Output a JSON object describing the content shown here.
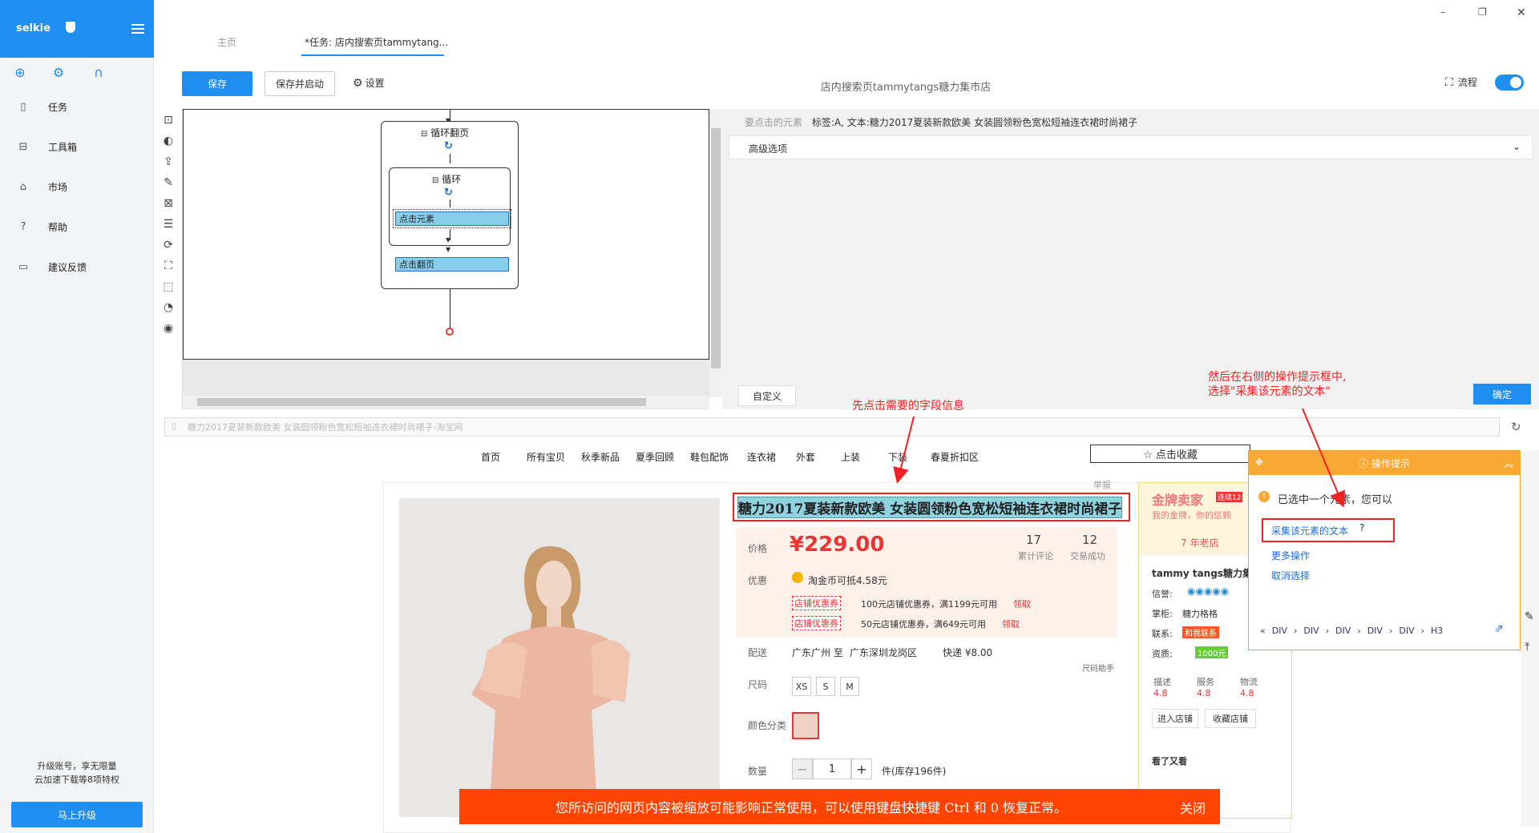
{
  "app": {
    "name": "selkie",
    "menu_label": "menu"
  },
  "sidebar": {
    "items": [
      {
        "label": "任务",
        "icon": "file-icon"
      },
      {
        "label": "工具箱",
        "icon": "toolbox-icon"
      },
      {
        "label": "市场",
        "icon": "bag-icon"
      },
      {
        "label": "帮助",
        "icon": "help-icon"
      },
      {
        "label": "建议反馈",
        "icon": "feedback-icon"
      }
    ],
    "upgrade_line1": "升级账号，享无限量",
    "upgrade_line2": "云加速下载等8项特权",
    "upgrade_button": "马上升级"
  },
  "tabs": [
    {
      "label": "主页"
    },
    {
      "label": "*任务: 店内搜索页tammytang..."
    }
  ],
  "toolbar": {
    "save": "保存",
    "save_run": "保存并启动",
    "settings": "设置",
    "title": "店内搜索页tammytangs糖力集市店",
    "flow": "流程"
  },
  "workflow": {
    "loop_page": "循环翻页",
    "loop": "循环",
    "click_element": "点击元素",
    "click_page": "点击翻页"
  },
  "props": {
    "head_label": "要点击的元素",
    "head_value": "标签:A, 文本:糖力2017夏装新款欧美 女装圆领粉色宽松短袖连衣裙时尚裙子",
    "advanced": "高级选项",
    "custom": "自定义",
    "ok": "确定"
  },
  "browser": {
    "address": "糖力2017夏装新款欧美 女装圆领粉色宽松短袖连衣裙时尚裙子-淘宝网"
  },
  "shop_nav": [
    "首页",
    "所有宝贝",
    "秋季新品",
    "夏季回顾",
    "鞋包配饰",
    "连衣裙",
    "外套",
    "上装",
    "下装",
    "春夏折扣区"
  ],
  "collect": "☆ 点击收藏",
  "product": {
    "report": "举报",
    "title": "糖力2017夏装新款欧美 女装圆领粉色宽松短袖连衣裙时尚裙子",
    "price_label": "价格",
    "price": "¥229.00",
    "reviews_count": "17",
    "reviews_label": "累计评论",
    "sales_count": "12",
    "sales_label": "交易成功",
    "promo_label": "优惠",
    "taobao_coin": "淘金币可抵4.58元",
    "coupon_tag": "店铺优惠券",
    "coupon1": "100元店铺优惠券，满1199元可用",
    "coupon2": "50元店铺优惠券，满649元可用",
    "claim": "领取",
    "ship_label": "配送",
    "ship_from": "广东广州 至",
    "ship_to": "广东深圳龙岗区",
    "ship_fee": "快递 ¥8.00",
    "size_helper": "尺码助手",
    "size_label": "尺码",
    "sizes": [
      "XS",
      "S",
      "M"
    ],
    "color_label": "颜色分类",
    "qty_label": "数量",
    "qty": "1",
    "stock": "件(库存196件)"
  },
  "zoom_banner": {
    "text": "您所访问的网页内容被缩放可能影响正常使用，可以使用键盘快捷键 Ctrl 和 0 恢复正常。",
    "close": "关闭"
  },
  "seller": {
    "gold": "金牌卖家",
    "streak": "连续12",
    "slogan": "我的金牌，你的信赖",
    "years": "7 年老店",
    "shop": "tammy tangs糖力集",
    "credit": "信誉:",
    "keeper": "掌柜:",
    "keeper_name": "糖力格格",
    "contact": "联系:",
    "contact_btn": "和我联系",
    "qual": "资质:",
    "deposit": "1000元",
    "desc": "描述",
    "service": "服务",
    "logistics": "物流",
    "score": "4.8",
    "enter": "进入店铺",
    "fav": "收藏店铺",
    "see_also": "看了又看"
  },
  "op_popup": {
    "title": "操作提示",
    "selected": "已选中一个元素，您可以",
    "collect_text": "采集该元素的文本",
    "more": "更多操作",
    "cancel": "取消选择",
    "crumbs": [
      "DIV",
      "DIV",
      "DIV",
      "DIV",
      "DIV",
      "H3"
    ]
  },
  "annotations": {
    "first": "先点击需要的字段信息",
    "second_l1": "然后在右侧的操作提示框中,",
    "second_l2": "选择\"采集该元素的文本\""
  },
  "colors": {
    "accent": "#1e8ef0",
    "annotation": "#ee2222",
    "banner": "#ff4300",
    "popup": "#f7a933"
  }
}
